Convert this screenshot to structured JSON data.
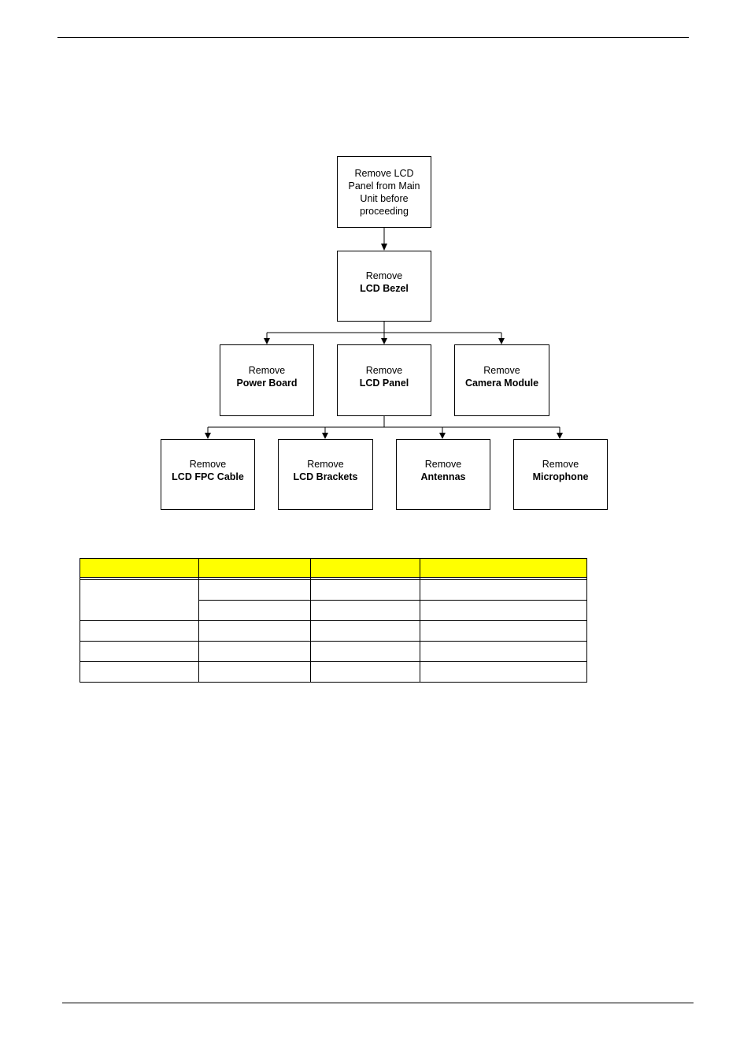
{
  "flowchart": {
    "root": {
      "line1": "Remove LCD",
      "line2": "Panel from Main",
      "line3": "Unit before",
      "line4": "proceeding"
    },
    "bezel": {
      "verb": "Remove",
      "item": "LCD Bezel"
    },
    "level2": [
      {
        "verb": "Remove",
        "item": "Power Board"
      },
      {
        "verb": "Remove",
        "item": "LCD Panel"
      },
      {
        "verb": "Remove",
        "item": "Camera Module"
      }
    ],
    "level3": [
      {
        "verb": "Remove",
        "item": "LCD FPC Cable"
      },
      {
        "verb": "Remove",
        "item": "LCD Brackets"
      },
      {
        "verb": "Remove",
        "item": "Antennas"
      },
      {
        "verb": "Remove",
        "item": "Microphone"
      }
    ]
  },
  "table": {
    "header_color": "#ffff00"
  }
}
